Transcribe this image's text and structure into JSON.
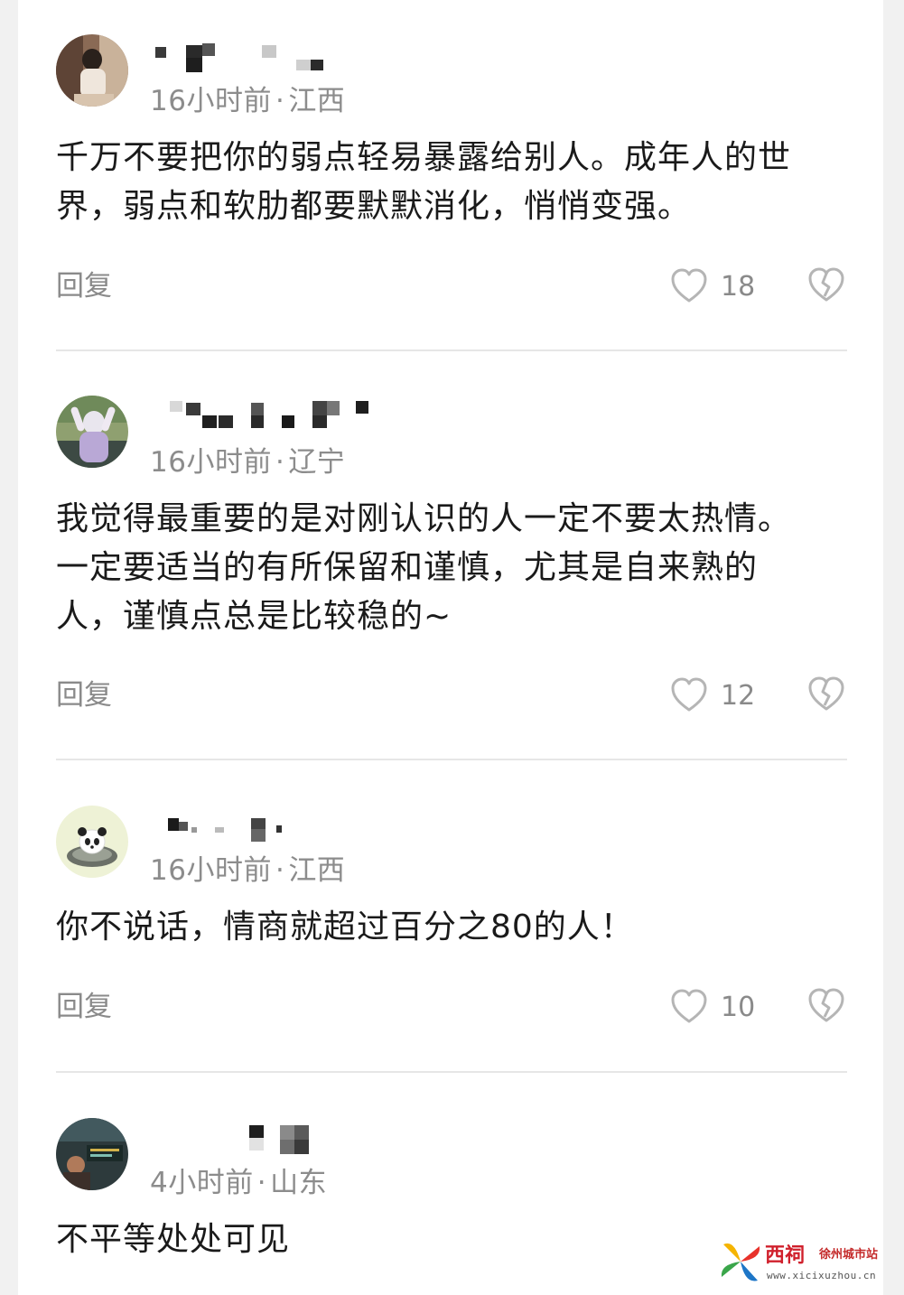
{
  "comments": [
    {
      "time": "16小时前",
      "region": "江西",
      "lines": [
        "千万不要把你的弱点轻易暴露给别人。成年人的世",
        "界，弱点和软肋都要默默消化，悄悄变强。"
      ],
      "reply_label": "回复",
      "likes": "18"
    },
    {
      "time": "16小时前",
      "region": "辽宁",
      "lines": [
        "我觉得最重要的是对刚认识的人一定不要太热情。",
        "一定要适当的有所保留和谨慎，尤其是自来熟的",
        "人，谨慎点总是比较稳的~"
      ],
      "reply_label": "回复",
      "likes": "12"
    },
    {
      "time": "16小时前",
      "region": "江西",
      "lines": [
        "你不说话，情商就超过百分之80的人！"
      ],
      "reply_label": "回复",
      "likes": "10"
    },
    {
      "time": "4小时前",
      "region": "山东",
      "lines": [
        "不平等处处可见"
      ]
    }
  ],
  "watermark": {
    "brand": "西祠",
    "site": "徐州城市站",
    "url": "www.xicixuzhou.cn"
  },
  "icons": {
    "like": "heart-outline-icon",
    "dislike": "broken-heart-icon"
  },
  "colors": {
    "meta_text": "#8c8c8c",
    "body_text": "#1a1a1a",
    "icon_gray": "#b5b5b5",
    "divider": "#e6e6e6",
    "watermark_red": "#d0202c"
  }
}
